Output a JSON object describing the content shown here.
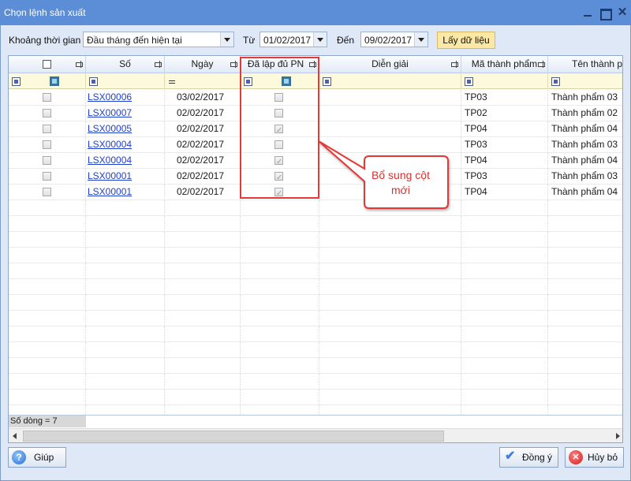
{
  "window": {
    "title": "Chọn lệnh sản xuất"
  },
  "filter": {
    "period_label": "Khoảng thời gian",
    "period_value": "Đầu tháng đến hiện tại",
    "from_label": "Từ",
    "from_value": "01/02/2017",
    "to_label": "Đến",
    "to_value": "09/02/2017",
    "fetch_button": "Lấy dữ liệu"
  },
  "grid": {
    "columns": {
      "so": "Số",
      "ngay": "Ngày",
      "da_lap": "Đã lập đủ PN",
      "dien_giai": "Diễn giải",
      "ma_tp": "Mã thành phẩm",
      "ten_tp": "Tên thành phẩ"
    },
    "rows": [
      {
        "so": "LSX00006",
        "ngay": "03/02/2017",
        "da_lap": false,
        "ma_tp": "TP03",
        "ten_tp": "Thành phẩm 03"
      },
      {
        "so": "LSX00007",
        "ngay": "02/02/2017",
        "da_lap": false,
        "ma_tp": "TP02",
        "ten_tp": "Thành phẩm 02"
      },
      {
        "so": "LSX00005",
        "ngay": "02/02/2017",
        "da_lap": true,
        "ma_tp": "TP04",
        "ten_tp": "Thành phẩm 04"
      },
      {
        "so": "LSX00004",
        "ngay": "02/02/2017",
        "da_lap": false,
        "ma_tp": "TP03",
        "ten_tp": "Thành phẩm 03"
      },
      {
        "so": "LSX00004",
        "ngay": "02/02/2017",
        "da_lap": true,
        "ma_tp": "TP04",
        "ten_tp": "Thành phẩm 04"
      },
      {
        "so": "LSX00001",
        "ngay": "02/02/2017",
        "da_lap": true,
        "ma_tp": "TP03",
        "ten_tp": "Thành phẩm 03"
      },
      {
        "so": "LSX00001",
        "ngay": "02/02/2017",
        "da_lap": true,
        "ma_tp": "TP04",
        "ten_tp": "Thành phẩm 04"
      }
    ],
    "row_count": "Số dòng = 7"
  },
  "callout": {
    "line1": "Bổ sung cột",
    "line2": "mới",
    "color": "#d8322f"
  },
  "buttons": {
    "help": "Giúp",
    "ok": "Đồng ý",
    "cancel": "Hủy bỏ"
  },
  "icons": {
    "help": "help-icon",
    "ok": "checkmark-icon",
    "cancel": "cancel-icon"
  }
}
